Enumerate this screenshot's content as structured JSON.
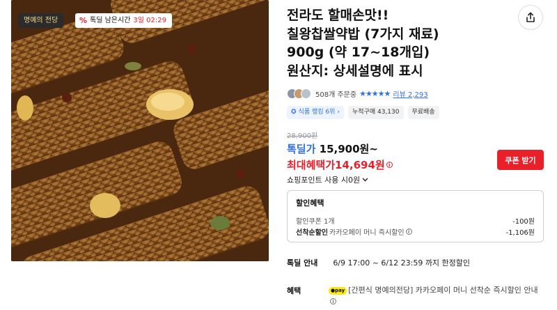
{
  "product_image": {
    "brand_badge": "명예의 전당",
    "timer": {
      "icon": "percent-icon",
      "percent_symbol": "%",
      "label": "톡딜 남은시간",
      "value": "3일 02:29"
    }
  },
  "product": {
    "title_lines": [
      "전라도 할매손맛!!",
      "칠왕찹쌀약밥 (7가지 재료)",
      "900g (약 17~18개입)",
      "원산지: 상세설명에 표시"
    ],
    "orders": "508개 주문중",
    "rating_stars": 5,
    "review_link": "리뷰 2,293",
    "chips": [
      "식품 랭킹 6위",
      "누적구매 43,130",
      "무료배송"
    ]
  },
  "price": {
    "original": "28,900원",
    "deal_label": "톡딜가",
    "deal_price": "15,900원~",
    "max_label": "최대혜택가",
    "max_price": "14,694원",
    "coupon_button": "쿠폰 받기",
    "points": "쇼핑포인트 사용 시0원"
  },
  "discount": {
    "title": "할인혜택",
    "rows": [
      {
        "label_bold": "",
        "label": "할인쿠폰 1개",
        "value": "-100원"
      },
      {
        "label_bold": "선착순할인",
        "label": "카카오페이 머니 즉시할인",
        "value": "-1,106원"
      }
    ]
  },
  "period": {
    "label": "톡딜 안내",
    "value": "6/9 17:00 ~ 6/12 23:59 까지 한정할인"
  },
  "benefit": {
    "label": "혜택",
    "pay_badge": "●pay",
    "text": "[간편식 명예의전당] 카카오페이 머니 선착순 즉시할인 안내"
  },
  "colors": {
    "accent_blue": "#2f6fe4",
    "accent_red": "#e8202a",
    "kakao_yellow": "#ffe812"
  }
}
